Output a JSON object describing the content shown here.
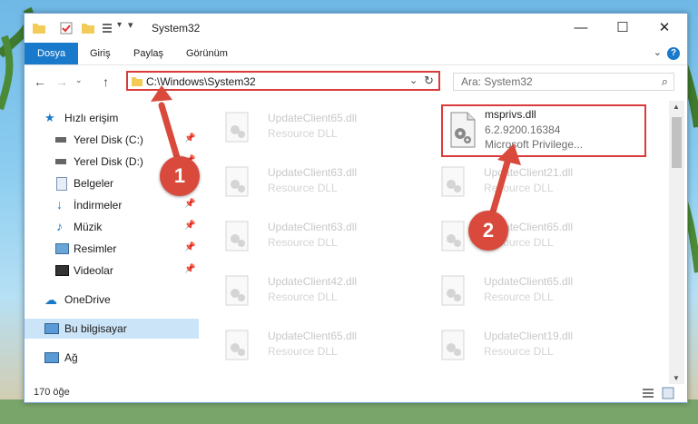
{
  "window": {
    "title": "System32"
  },
  "ribbon": {
    "tabs": [
      "Dosya",
      "Giriş",
      "Paylaş",
      "Görünüm"
    ]
  },
  "address": {
    "path": "C:\\Windows\\System32"
  },
  "search": {
    "placeholder": "Ara: System32"
  },
  "sidebar": {
    "items": [
      {
        "label": "Hızlı erişim",
        "icon": "star-icon"
      },
      {
        "label": "Yerel Disk (C:)",
        "icon": "drive-icon",
        "pinned": true
      },
      {
        "label": "Yerel Disk (D:)",
        "icon": "drive-icon",
        "pinned": true
      },
      {
        "label": "Belgeler",
        "icon": "document-icon",
        "pinned": true
      },
      {
        "label": "İndirmeler",
        "icon": "download-icon",
        "pinned": true
      },
      {
        "label": "Müzik",
        "icon": "music-icon",
        "pinned": true
      },
      {
        "label": "Resimler",
        "icon": "pictures-icon",
        "pinned": true
      },
      {
        "label": "Videolar",
        "icon": "video-icon",
        "pinned": true
      },
      {
        "label": "OneDrive",
        "icon": "cloud-icon"
      },
      {
        "label": "Bu bilgisayar",
        "icon": "computer-icon",
        "selected": true
      },
      {
        "label": "Ağ",
        "icon": "network-icon"
      }
    ]
  },
  "files": {
    "left": [
      {
        "name": "UpdateClient65.dll",
        "type": "Resource DLL"
      },
      {
        "name": "UpdateClient63.dll",
        "type": "Resource DLL"
      },
      {
        "name": "UpdateClient63.dll",
        "type": "Resource DLL"
      },
      {
        "name": "UpdateClient42.dll",
        "type": "Resource DLL"
      },
      {
        "name": "UpdateClient65.dll",
        "type": "Resource DLL"
      }
    ],
    "right": [
      {
        "name": "UpdateClient21.dll",
        "type": "Resource DLL"
      },
      {
        "name": "UpdateClient65.dll",
        "type": "Resource DLL"
      },
      {
        "name": "UpdateClient65.dll",
        "type": "Resource DLL"
      },
      {
        "name": "UpdateClient19.dll",
        "type": "Resource DLL"
      }
    ],
    "highlighted": {
      "name": "msprivs.dll",
      "version": "6.2.9200.16384",
      "description": "Microsoft Privilege..."
    }
  },
  "status": {
    "count": "170 öğe"
  },
  "callouts": [
    "1",
    "2"
  ],
  "colors": {
    "accent": "#1979ca",
    "highlight": "#d93b3b",
    "badge": "#d94a3d"
  }
}
